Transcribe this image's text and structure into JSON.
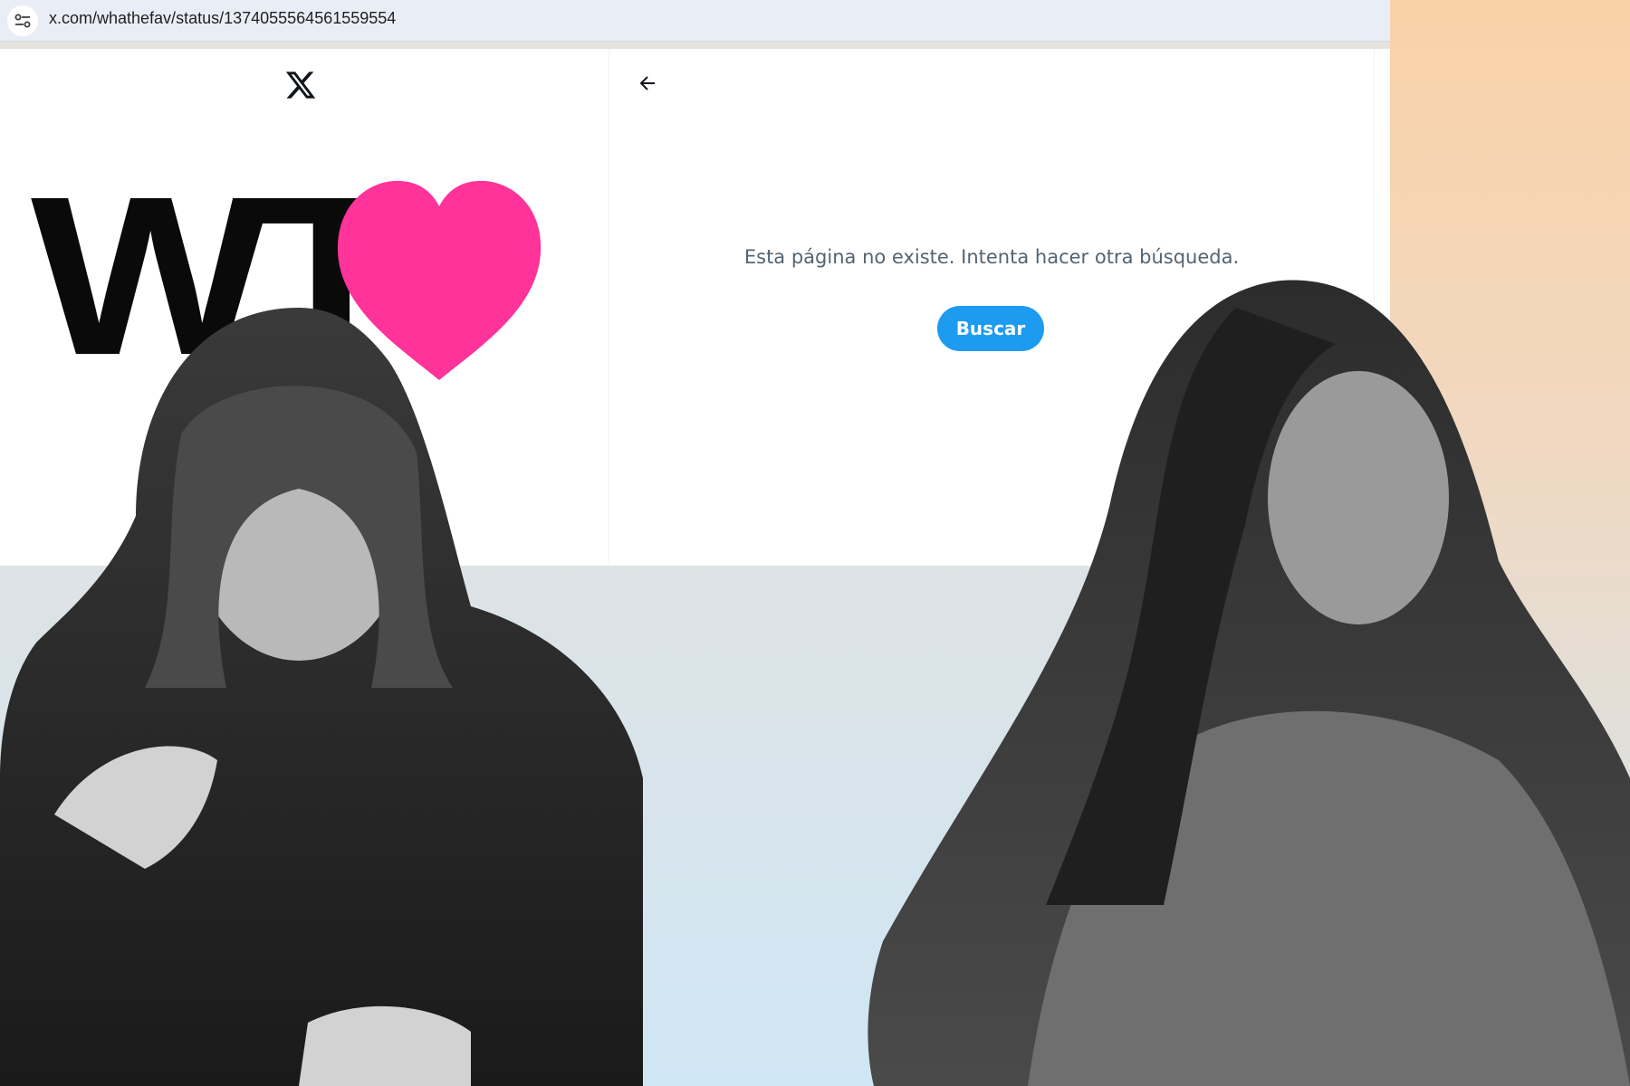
{
  "browser": {
    "url": "x.com/whathefav/status/1374055564561559554"
  },
  "page": {
    "message": "Esta página no existe. Intenta hacer otra búsqueda.",
    "search_button_label": "Buscar"
  },
  "overlay": {
    "logo_text": "WT"
  },
  "colors": {
    "twitter_blue": "#1d9bf0",
    "heart_pink": "#ff3399",
    "muted_text": "#536471"
  },
  "icons": [
    "site-info-icon",
    "x-logo-icon",
    "back-arrow-icon",
    "heart-icon"
  ]
}
